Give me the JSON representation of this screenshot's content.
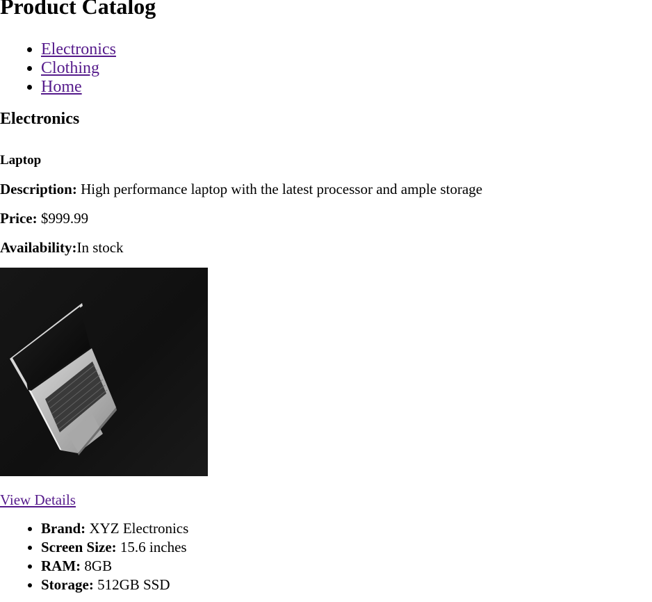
{
  "page": {
    "title": "Product Catalog"
  },
  "nav": {
    "items": [
      {
        "label": "Electronics"
      },
      {
        "label": "Clothing"
      },
      {
        "label": "Home"
      }
    ]
  },
  "section": {
    "title": "Electronics"
  },
  "product": {
    "name": "Laptop",
    "description_label": "Description:",
    "description": "High performance laptop with the latest processor and ample storage",
    "price_label": "Price:",
    "price": "$999.99",
    "availability_label": "Availability:",
    "availability": "In stock",
    "details_link": "View Details",
    "specs": [
      {
        "label": "Brand:",
        "value": "XYZ Electronics"
      },
      {
        "label": "Screen Size:",
        "value": "15.6 inches"
      },
      {
        "label": "RAM:",
        "value": "8GB"
      },
      {
        "label": "Storage:",
        "value": "512GB SSD"
      }
    ]
  },
  "colors": {
    "link": "#551a8b",
    "text": "#000000",
    "background": "#ffffff",
    "image_background": "#111111"
  }
}
